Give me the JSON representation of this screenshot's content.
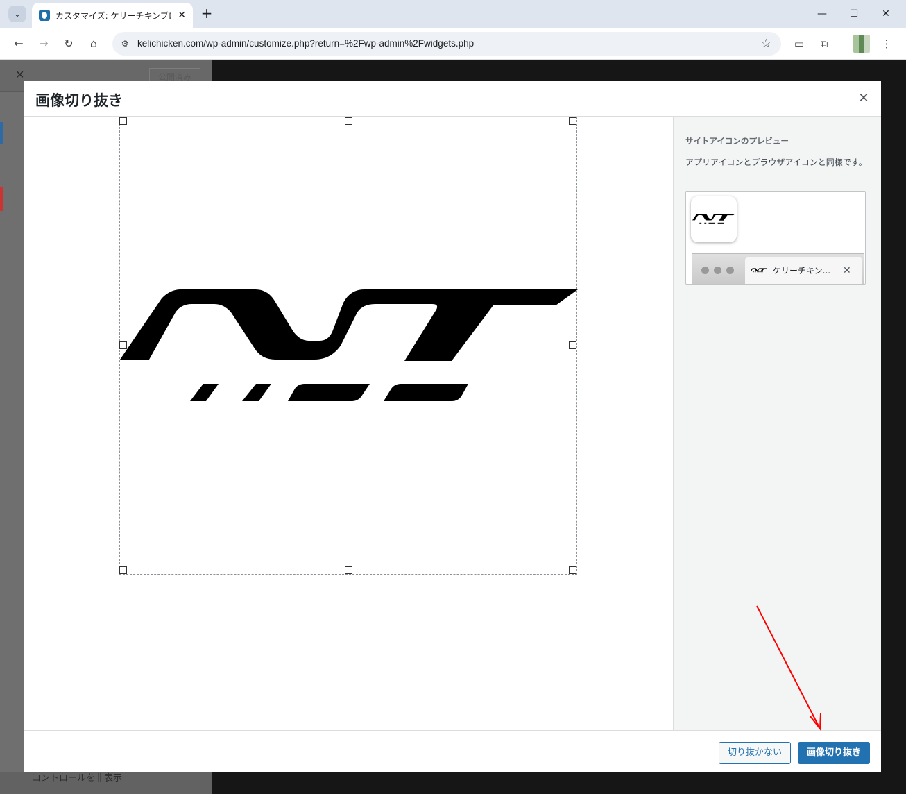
{
  "browser": {
    "tab_title": "カスタマイズ: ケリーチキンブログ | ケリ",
    "url": "kelichicken.com/wp-admin/customize.php?return=%2Fwp-admin%2Fwidgets.php",
    "icons": {
      "tab_search": "chevron-down-icon",
      "back": "back-arrow-icon",
      "forward": "forward-arrow-icon",
      "reload": "reload-icon",
      "home": "home-icon",
      "site_info": "tune-icon",
      "bookmark": "star-icon",
      "extension": "puzzle-icon",
      "menu": "kebab-menu-icon"
    }
  },
  "background_page": {
    "publish_label": "公開済み",
    "footer_label": "コントロールを非表示"
  },
  "modal": {
    "title": "画像切り抜き",
    "side": {
      "heading": "サイトアイコンのプレビュー",
      "description": "アプリアイコンとブラウザアイコンと同様です。",
      "tab_title": "ケリーチキン..."
    },
    "buttons": {
      "skip": "切り抜かない",
      "crop": "画像切り抜き"
    }
  },
  "colors": {
    "accent": "#2271b1",
    "annotation_arrow": "#ff0000"
  }
}
